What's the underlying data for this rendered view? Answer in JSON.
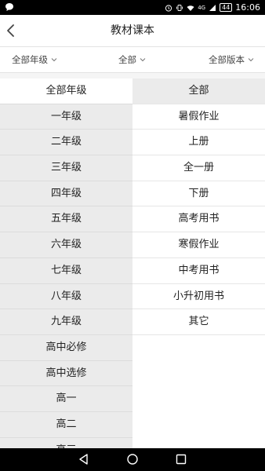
{
  "status_bar": {
    "time": "16:06",
    "battery": "44",
    "network": "4G"
  },
  "header": {
    "title": "教材课本"
  },
  "filters": [
    {
      "label": "全部年级"
    },
    {
      "label": "全部"
    },
    {
      "label": "全部版本"
    }
  ],
  "grades": [
    {
      "label": "全部年级",
      "selected": true
    },
    {
      "label": "一年级"
    },
    {
      "label": "二年级"
    },
    {
      "label": "三年级"
    },
    {
      "label": "四年级"
    },
    {
      "label": "五年级"
    },
    {
      "label": "六年级"
    },
    {
      "label": "七年级"
    },
    {
      "label": "八年级"
    },
    {
      "label": "九年级"
    },
    {
      "label": "高中必修"
    },
    {
      "label": "高中选修"
    },
    {
      "label": "高一"
    },
    {
      "label": "高二"
    },
    {
      "label": "高三"
    }
  ],
  "categories": [
    {
      "label": "全部",
      "selected": true
    },
    {
      "label": "暑假作业"
    },
    {
      "label": "上册"
    },
    {
      "label": "全一册"
    },
    {
      "label": "下册"
    },
    {
      "label": "高考用书"
    },
    {
      "label": "寒假作业"
    },
    {
      "label": "中考用书"
    },
    {
      "label": "小升初用书"
    },
    {
      "label": "其它"
    }
  ],
  "icons": {
    "back": "chevron-left-icon",
    "filter_arrow": "chevron-down-icon"
  }
}
